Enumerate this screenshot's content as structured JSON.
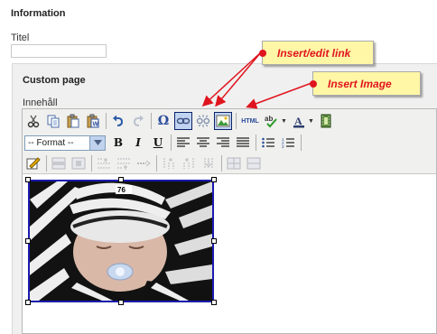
{
  "information": {
    "title": "Information"
  },
  "titel": {
    "label": "Titel",
    "value": ""
  },
  "custom_page": {
    "title": "Custom page"
  },
  "content": {
    "label": "Innehåll"
  },
  "toolbar": {
    "format_value": "-- Format --",
    "bold": "B",
    "italic": "I",
    "underline": "U",
    "html_label": "HTML",
    "spell_label": "ab",
    "font_color_label": "A",
    "omega": "Ω"
  },
  "callouts": {
    "link": "Insert/edit link",
    "image": "Insert Image"
  },
  "colors": {
    "callout_bg": "#fff7a6",
    "callout_text": "#e0141e",
    "selection_border": "#1b1bb0"
  }
}
